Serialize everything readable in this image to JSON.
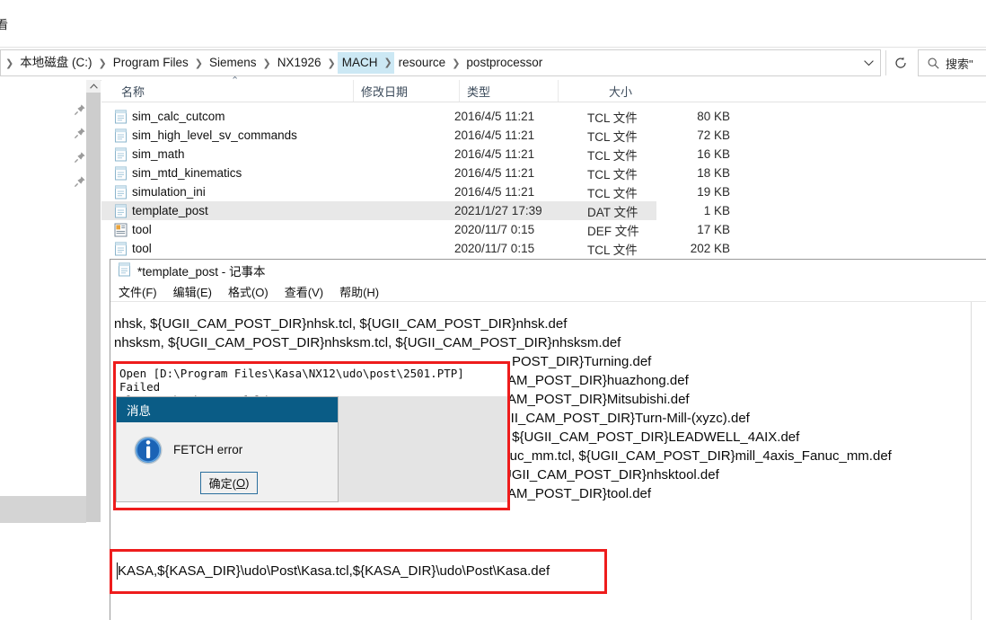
{
  "explorer": {
    "ribbon_clip_text": "看",
    "breadcrumb": [
      {
        "label": "本地磁盘 (C:)",
        "active": false
      },
      {
        "label": "Program Files",
        "active": false
      },
      {
        "label": "Siemens",
        "active": false
      },
      {
        "label": "NX1926",
        "active": false
      },
      {
        "label": "MACH",
        "active": true
      },
      {
        "label": "resource",
        "active": false
      },
      {
        "label": "postprocessor",
        "active": false
      }
    ],
    "search": {
      "placeholder": "搜索\""
    },
    "columns": {
      "name": "名称",
      "date": "修改日期",
      "type": "类型",
      "size": "大小"
    },
    "sort_indicator": "⌃",
    "files": [
      {
        "name": "sim_calc_cutcom",
        "date": "2016/4/5 11:21",
        "type": "TCL 文件",
        "size": "80 KB",
        "icon": "text-file-icon",
        "selected": false
      },
      {
        "name": "sim_high_level_sv_commands",
        "date": "2016/4/5 11:21",
        "type": "TCL 文件",
        "size": "72 KB",
        "icon": "text-file-icon",
        "selected": false
      },
      {
        "name": "sim_math",
        "date": "2016/4/5 11:21",
        "type": "TCL 文件",
        "size": "16 KB",
        "icon": "text-file-icon",
        "selected": false
      },
      {
        "name": "sim_mtd_kinematics",
        "date": "2016/4/5 11:21",
        "type": "TCL 文件",
        "size": "18 KB",
        "icon": "text-file-icon",
        "selected": false
      },
      {
        "name": "simulation_ini",
        "date": "2016/4/5 11:21",
        "type": "TCL 文件",
        "size": "19 KB",
        "icon": "text-file-icon",
        "selected": false
      },
      {
        "name": "template_post",
        "date": "2021/1/27 17:39",
        "type": "DAT 文件",
        "size": "1 KB",
        "icon": "text-file-icon",
        "selected": true
      },
      {
        "name": "tool",
        "date": "2020/11/7 0:15",
        "type": "DEF 文件",
        "size": "17 KB",
        "icon": "def-file-icon",
        "selected": false
      },
      {
        "name": "tool",
        "date": "2020/11/7 0:15",
        "type": "TCL 文件",
        "size": "202 KB",
        "icon": "text-file-icon",
        "selected": false
      }
    ]
  },
  "notepad": {
    "title": "*template_post - 记事本",
    "menu": [
      "文件(F)",
      "编辑(E)",
      "格式(O)",
      "查看(V)",
      "帮助(H)"
    ],
    "lines": [
      "nhsk, ${UGII_CAM_POST_DIR}nhsk.tcl, ${UGII_CAM_POST_DIR}nhsk.def",
      "nhsksm, ${UGII_CAM_POST_DIR}nhsksm.tcl, ${UGII_CAM_POST_DIR}nhsksm.def",
      "POST_DIR}Turning.def",
      "AM_POST_DIR}huazhong.def",
      "AM_POST_DIR}Mitsubishi.def",
      "GII_CAM_POST_DIR}Turn-Mill-(xyzc).def",
      "cl, ${UGII_CAM_POST_DIR}LEADWELL_4AIX.def",
      "anuc_mm.tcl, ${UGII_CAM_POST_DIR}mill_4axis_Fanuc_mm.def",
      "UGII_CAM_POST_DIR}nhsktool.def",
      "AM_POST_DIR}tool.def"
    ],
    "kasa_line": "KASA,${KASA_DIR}\\udo\\Post\\Kasa.tcl,${KASA_DIR}\\udo\\Post\\Kasa.def"
  },
  "error_dialog": {
    "console_line_1": "Open [D:\\Program Files\\Kasa\\NX12\\udo\\post\\2501.PTP] Failed",
    "console_line_2": "Please Check your folder..",
    "title": "消息",
    "message": "FETCH error",
    "ok_label_pre": "确定(",
    "ok_label_accel": "O",
    "ok_label_post": ")"
  },
  "colors": {
    "highlight_red": "#ee1c1c",
    "dialog_titlebar": "#0a5c86",
    "breadcrumb_active": "#cce8f4",
    "row_selected": "#e8e8e8"
  }
}
